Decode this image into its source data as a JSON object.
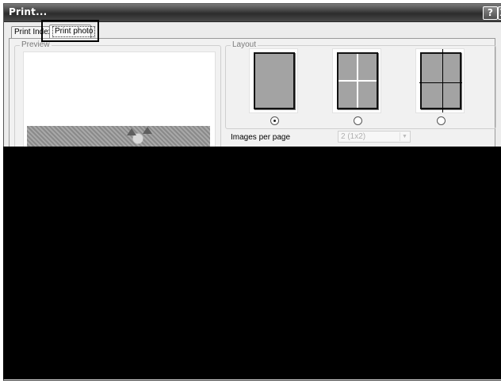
{
  "window": {
    "title": "Print...",
    "help_icon": "?",
    "close_icon": "X"
  },
  "tabs": [
    {
      "label": "Print Index",
      "selected": false
    },
    {
      "label": "Print photo",
      "selected": true
    }
  ],
  "preview": {
    "group_label": "Preview"
  },
  "layout": {
    "group_label": "Layout",
    "options": [
      {
        "name": "single-image-layout",
        "selected": true
      },
      {
        "name": "four-grid-layout",
        "selected": false
      },
      {
        "name": "crosshair-layout",
        "selected": false
      }
    ]
  },
  "images_per_page": {
    "label": "Images per page",
    "value": "2 (1x2)",
    "enabled": false
  }
}
